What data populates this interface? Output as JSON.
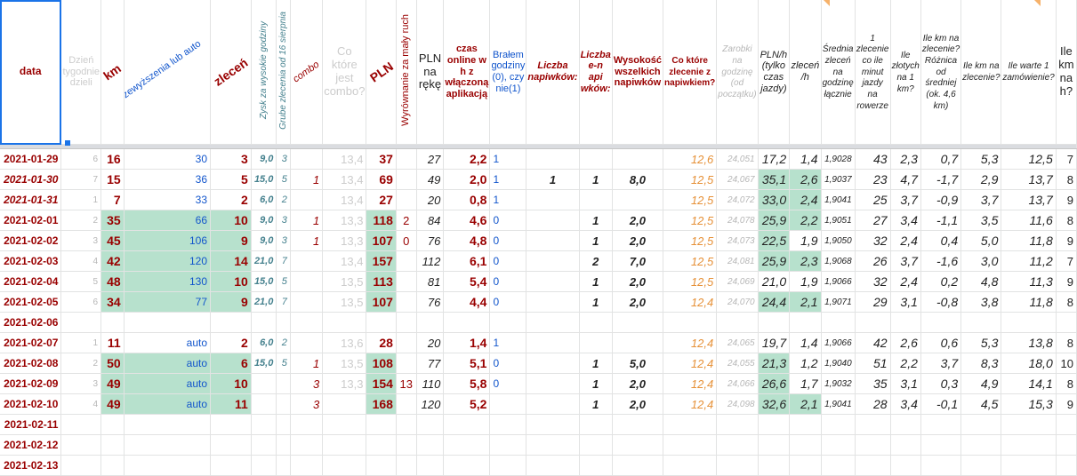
{
  "headers": [
    "data",
    "Dzień tygodnie dzieli",
    "km",
    "przewyższenia lub auto",
    "zleceń",
    "Zysk za wysokie godziny",
    "Grube zlecenia od 16 sierpnia",
    "combo",
    "Co które jest combo?",
    "PLN",
    "Wyrównanie za mały ruch",
    "PLN na rękę",
    "czas online w h z włączoną aplikacją",
    "Brałem godziny (0), czy nie(1)",
    "Liczba napiwków:",
    "Liczba e-n api wków:",
    "Wysokość wszelkich napiwków",
    "Co które zlecenie z napiwkiem?",
    "Zarobki na godzinę (od początku)",
    "PLN/h (tylko czas jazdy)",
    "zleceń /h",
    "Średnia zleceń na godzinę łącznie",
    "1 zlecenie co ile minut jazdy na rowerze",
    "Ile złotych na 1 km?",
    "Ile km na zlecenie? Różnica od średniej (ok. 4,6 km)",
    "Ile km na zlecenie?",
    "Ile warte 1 zamówienie?",
    "Ile km na h?"
  ],
  "rows": [
    {
      "d": "2021-01-29",
      "wd": "6",
      "km": "16",
      "pa": "30",
      "z": "3",
      "zg": "9,0",
      "gz": "3",
      "cb": "",
      "cc": "13,4",
      "pln": "37",
      "wy": "",
      "pr": "27",
      "co": "2,2",
      "bg": "1",
      "ln": "",
      "le": "",
      "wn": "",
      "cz": "12,6",
      "zh": "24,051",
      "plnh": "17,2",
      "zlh": "1,4",
      "sr": "1,9028",
      "min": "43",
      "zk": "2,3",
      "roz": "0,7",
      "kz": "5,3",
      "w1": "12,5",
      "kmh": "7",
      "g": []
    },
    {
      "d": "2021-01-30",
      "wd": "7",
      "km": "15",
      "pa": "36",
      "z": "5",
      "zg": "15,0",
      "gz": "5",
      "cb": "1",
      "cc": "13,4",
      "pln": "69",
      "wy": "",
      "pr": "49",
      "co": "2,0",
      "bg": "1",
      "ln": "1",
      "le": "1",
      "wn": "8,0",
      "cz": "12,5",
      "zh": "24,067",
      "plnh": "35,1",
      "zlh": "2,6",
      "sr": "1,9037",
      "min": "23",
      "zk": "4,7",
      "roz": "-1,7",
      "kz": "2,9",
      "w1": "13,7",
      "kmh": "8",
      "g": [
        "plnh",
        "zlh"
      ],
      "di": true
    },
    {
      "d": "2021-01-31",
      "wd": "1",
      "km": "7",
      "pa": "33",
      "z": "2",
      "zg": "6,0",
      "gz": "2",
      "cb": "",
      "cc": "13,4",
      "pln": "27",
      "wy": "",
      "pr": "20",
      "co": "0,8",
      "bg": "1",
      "ln": "",
      "le": "",
      "wn": "",
      "cz": "12,5",
      "zh": "24,072",
      "plnh": "33,0",
      "zlh": "2,4",
      "sr": "1,9041",
      "min": "25",
      "zk": "3,7",
      "roz": "-0,9",
      "kz": "3,7",
      "w1": "13,7",
      "kmh": "9",
      "g": [
        "plnh",
        "zlh"
      ],
      "di": true
    },
    {
      "d": "2021-02-01",
      "wd": "2",
      "km": "35",
      "pa": "66",
      "z": "10",
      "zg": "9,0",
      "gz": "3",
      "cb": "1",
      "cc": "13,3",
      "pln": "118",
      "wy": "2",
      "pr": "84",
      "co": "4,6",
      "bg": "0",
      "ln": "",
      "le": "1",
      "wn": "2,0",
      "cz": "12,5",
      "zh": "24,078",
      "plnh": "25,9",
      "zlh": "2,2",
      "sr": "1,9051",
      "min": "27",
      "zk": "3,4",
      "roz": "-1,1",
      "kz": "3,5",
      "w1": "11,6",
      "kmh": "8",
      "g": [
        "km",
        "pa",
        "z",
        "pln",
        "plnh",
        "zlh"
      ]
    },
    {
      "d": "2021-02-02",
      "wd": "3",
      "km": "45",
      "pa": "106",
      "z": "9",
      "zg": "9,0",
      "gz": "3",
      "cb": "1",
      "cc": "13,3",
      "pln": "107",
      "wy": "0",
      "pr": "76",
      "co": "4,8",
      "bg": "0",
      "ln": "",
      "le": "1",
      "wn": "2,0",
      "cz": "12,5",
      "zh": "24,073",
      "plnh": "22,5",
      "zlh": "1,9",
      "sr": "1,9050",
      "min": "32",
      "zk": "2,4",
      "roz": "0,4",
      "kz": "5,0",
      "w1": "11,8",
      "kmh": "9",
      "g": [
        "km",
        "pa",
        "z",
        "pln",
        "plnh"
      ]
    },
    {
      "d": "2021-02-03",
      "wd": "4",
      "km": "42",
      "pa": "120",
      "z": "14",
      "zg": "21,0",
      "gz": "7",
      "cb": "",
      "cc": "13,4",
      "pln": "157",
      "wy": "",
      "pr": "112",
      "co": "6,1",
      "bg": "0",
      "ln": "",
      "le": "2",
      "wn": "7,0",
      "cz": "12,5",
      "zh": "24,081",
      "plnh": "25,9",
      "zlh": "2,3",
      "sr": "1,9068",
      "min": "26",
      "zk": "3,7",
      "roz": "-1,6",
      "kz": "3,0",
      "w1": "11,2",
      "kmh": "7",
      "g": [
        "km",
        "pa",
        "z",
        "pln",
        "plnh",
        "zlh"
      ]
    },
    {
      "d": "2021-02-04",
      "wd": "5",
      "km": "48",
      "pa": "130",
      "z": "10",
      "zg": "15,0",
      "gz": "5",
      "cb": "",
      "cc": "13,5",
      "pln": "113",
      "wy": "",
      "pr": "81",
      "co": "5,4",
      "bg": "0",
      "ln": "",
      "le": "1",
      "wn": "2,0",
      "cz": "12,5",
      "zh": "24,069",
      "plnh": "21,0",
      "zlh": "1,9",
      "sr": "1,9066",
      "min": "32",
      "zk": "2,4",
      "roz": "0,2",
      "kz": "4,8",
      "w1": "11,3",
      "kmh": "9",
      "g": [
        "km",
        "pa",
        "z",
        "pln"
      ]
    },
    {
      "d": "2021-02-05",
      "wd": "6",
      "km": "34",
      "pa": "77",
      "z": "9",
      "zg": "21,0",
      "gz": "7",
      "cb": "",
      "cc": "13,5",
      "pln": "107",
      "wy": "",
      "pr": "76",
      "co": "4,4",
      "bg": "0",
      "ln": "",
      "le": "1",
      "wn": "2,0",
      "cz": "12,4",
      "zh": "24,070",
      "plnh": "24,4",
      "zlh": "2,1",
      "sr": "1,9071",
      "min": "29",
      "zk": "3,1",
      "roz": "-0,8",
      "kz": "3,8",
      "w1": "11,8",
      "kmh": "8",
      "g": [
        "km",
        "pa",
        "z",
        "pln",
        "plnh",
        "zlh"
      ]
    },
    {
      "d": "2021-02-06",
      "empty": true
    },
    {
      "d": "2021-02-07",
      "wd": "1",
      "km": "11",
      "pa": "auto",
      "z": "2",
      "zg": "6,0",
      "gz": "2",
      "cb": "",
      "cc": "13,6",
      "pln": "28",
      "wy": "",
      "pr": "20",
      "co": "1,4",
      "bg": "1",
      "ln": "",
      "le": "",
      "wn": "",
      "cz": "12,4",
      "zh": "24,065",
      "plnh": "19,7",
      "zlh": "1,4",
      "sr": "1,9066",
      "min": "42",
      "zk": "2,6",
      "roz": "0,6",
      "kz": "5,3",
      "w1": "13,8",
      "kmh": "8",
      "g": []
    },
    {
      "d": "2021-02-08",
      "wd": "2",
      "km": "50",
      "pa": "auto",
      "z": "6",
      "zg": "15,0",
      "gz": "5",
      "cb": "1",
      "cc": "13,5",
      "pln": "108",
      "wy": "",
      "pr": "77",
      "co": "5,1",
      "bg": "0",
      "ln": "",
      "le": "1",
      "wn": "5,0",
      "cz": "12,4",
      "zh": "24,055",
      "plnh": "21,3",
      "zlh": "1,2",
      "sr": "1,9040",
      "min": "51",
      "zk": "2,2",
      "roz": "3,7",
      "kz": "8,3",
      "w1": "18,0",
      "kmh": "10",
      "g": [
        "km",
        "pa",
        "z",
        "pln",
        "plnh"
      ]
    },
    {
      "d": "2021-02-09",
      "wd": "3",
      "km": "49",
      "pa": "auto",
      "z": "10",
      "zg": "",
      "gz": "",
      "cb": "3",
      "cc": "13,3",
      "pln": "154",
      "wy": "13",
      "pr": "110",
      "co": "5,8",
      "bg": "0",
      "ln": "",
      "le": "1",
      "wn": "2,0",
      "cz": "12,4",
      "zh": "24,066",
      "plnh": "26,6",
      "zlh": "1,7",
      "sr": "1,9032",
      "min": "35",
      "zk": "3,1",
      "roz": "0,3",
      "kz": "4,9",
      "w1": "14,1",
      "kmh": "8",
      "g": [
        "km",
        "pa",
        "z",
        "pln",
        "plnh"
      ]
    },
    {
      "d": "2021-02-10",
      "wd": "4",
      "km": "49",
      "pa": "auto",
      "z": "11",
      "zg": "",
      "gz": "",
      "cb": "3",
      "cc": "",
      "pln": "168",
      "wy": "",
      "pr": "120",
      "co": "5,2",
      "bg": "",
      "ln": "",
      "le": "1",
      "wn": "2,0",
      "cz": "12,4",
      "zh": "24,098",
      "plnh": "32,6",
      "zlh": "2,1",
      "sr": "1,9041",
      "min": "28",
      "zk": "3,4",
      "roz": "-0,1",
      "kz": "4,5",
      "w1": "15,3",
      "kmh": "9",
      "g": [
        "km",
        "pa",
        "z",
        "pln",
        "plnh",
        "zlh"
      ]
    },
    {
      "d": "2021-02-11",
      "empty": true
    },
    {
      "d": "2021-02-12",
      "empty": true
    },
    {
      "d": "2021-02-13",
      "empty": true
    }
  ],
  "colors": {
    "dark_red": "#990000",
    "green": "#b7e1cd",
    "blue": "#1155cc",
    "teal": "#45818e",
    "orange": "#e69138"
  }
}
